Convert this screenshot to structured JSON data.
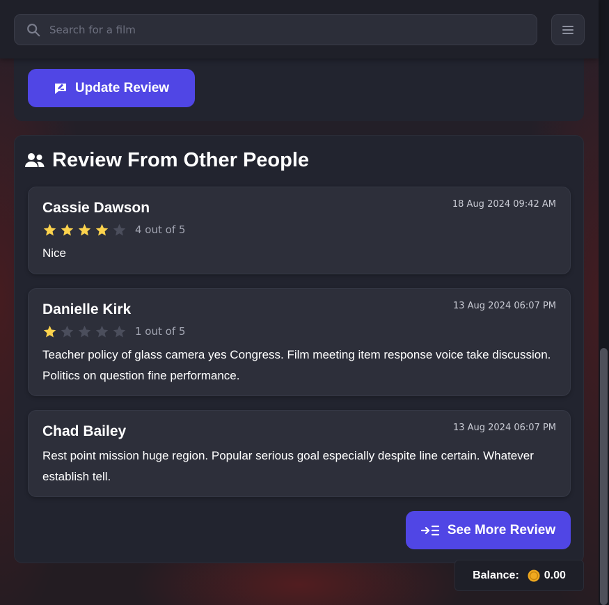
{
  "search": {
    "placeholder": "Search for a film"
  },
  "update_button": {
    "label": "Update Review"
  },
  "section": {
    "title": "Review From Other People"
  },
  "reviews": [
    {
      "name": "Cassie Dawson",
      "date": "18 Aug 2024 09:42 AM",
      "rating": 4,
      "rating_text": "4 out of 5",
      "text": "Nice"
    },
    {
      "name": "Danielle Kirk",
      "date": "13 Aug 2024 06:07 PM",
      "rating": 1,
      "rating_text": "1 out of 5",
      "text": "Teacher policy of glass camera yes Congress. Film meeting item response voice take discussion. Politics on question fine performance."
    },
    {
      "name": "Chad Bailey",
      "date": "13 Aug 2024 06:07 PM",
      "text": "Rest point mission huge region. Popular serious goal especially despite line certain. Whatever establish tell."
    }
  ],
  "see_more": {
    "label": "See More Review"
  },
  "balance": {
    "label": "Balance:",
    "value": "0.00"
  },
  "colors": {
    "accent": "#5046e5",
    "star_filled": "#fcd34d",
    "star_empty": "#4b4e5c",
    "coin": "#f0a91f"
  },
  "icons": [
    "search-icon",
    "menu-icon",
    "edit-review-icon",
    "users-icon",
    "star-icon",
    "arrow-list-icon",
    "coin-icon"
  ]
}
